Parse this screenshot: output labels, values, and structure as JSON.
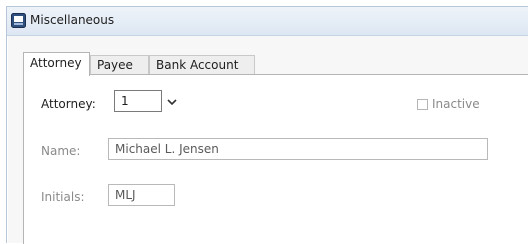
{
  "window": {
    "title": "Miscellaneous"
  },
  "tabs": [
    {
      "label": "Attorney"
    },
    {
      "label": "Payee"
    },
    {
      "label": "Bank Account"
    }
  ],
  "attorney": {
    "label": "Attorney:",
    "value": "1",
    "dropdown_glyph": "⌄"
  },
  "inactive": {
    "label": "Inactive",
    "checked": false
  },
  "name": {
    "label": "Name:",
    "value": "Michael L. Jensen"
  },
  "initials": {
    "label": "Initials:",
    "value": "MLJ"
  }
}
